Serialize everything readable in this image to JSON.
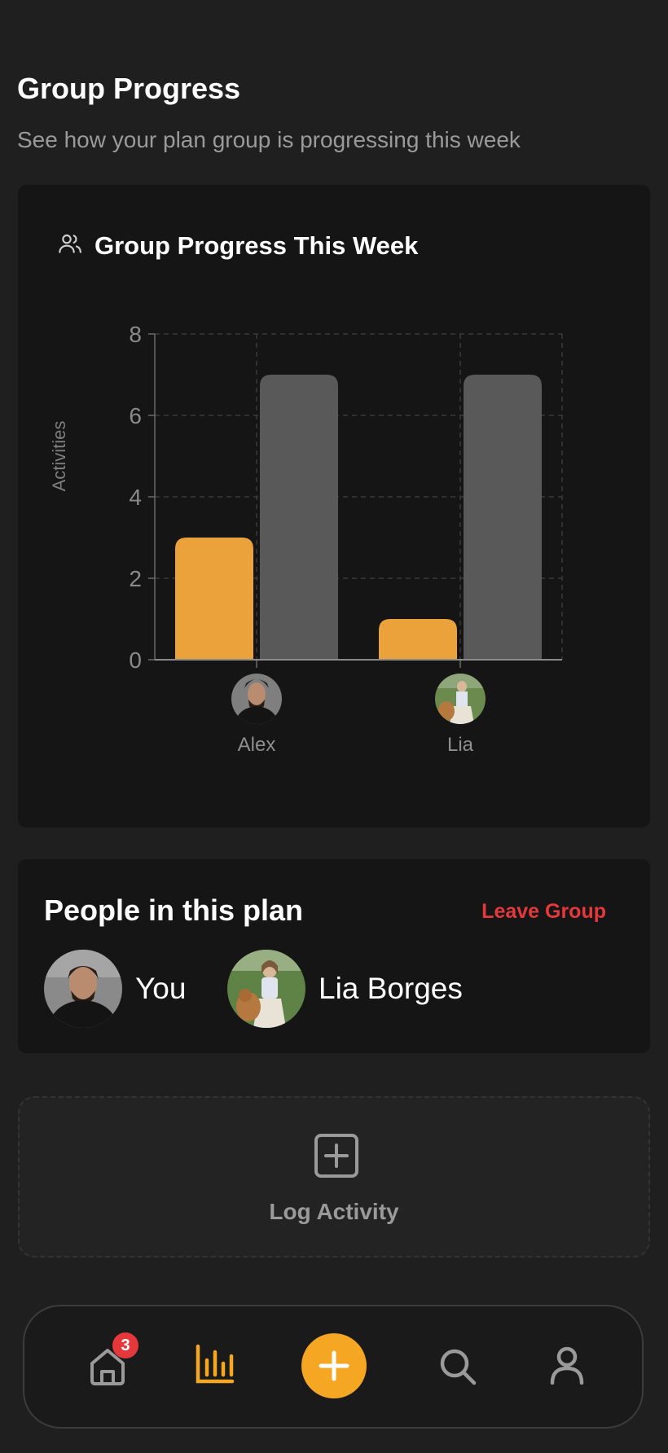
{
  "header": {
    "title": "Group Progress",
    "subtitle": "See how your plan group is progressing this week"
  },
  "chart_card": {
    "title": "Group Progress This Week",
    "icon": "users-icon"
  },
  "chart_data": {
    "type": "bar",
    "title": "Group Progress This Week",
    "ylabel": "Activities",
    "xlabel": "",
    "ylim": [
      0,
      8
    ],
    "yticks": [
      "0",
      "2",
      "4",
      "6",
      "8"
    ],
    "categories": [
      "Alex",
      "Lia"
    ],
    "series": [
      {
        "values": [
          3,
          1
        ],
        "color": "#eba23b"
      },
      {
        "values": [
          7,
          7
        ],
        "color": "#595959"
      }
    ],
    "grid": true
  },
  "people": {
    "title": "People in this plan",
    "leave_label": "Leave Group",
    "members": [
      {
        "name": "You"
      },
      {
        "name": "Lia Borges"
      }
    ]
  },
  "log_activity": {
    "label": "Log Activity",
    "icon": "plus-square-icon"
  },
  "nav": {
    "home_badge": "3",
    "items": [
      "home-icon",
      "stats-icon",
      "add-icon",
      "search-icon",
      "profile-icon"
    ],
    "active": "stats-icon",
    "accent": "#f5a623"
  }
}
